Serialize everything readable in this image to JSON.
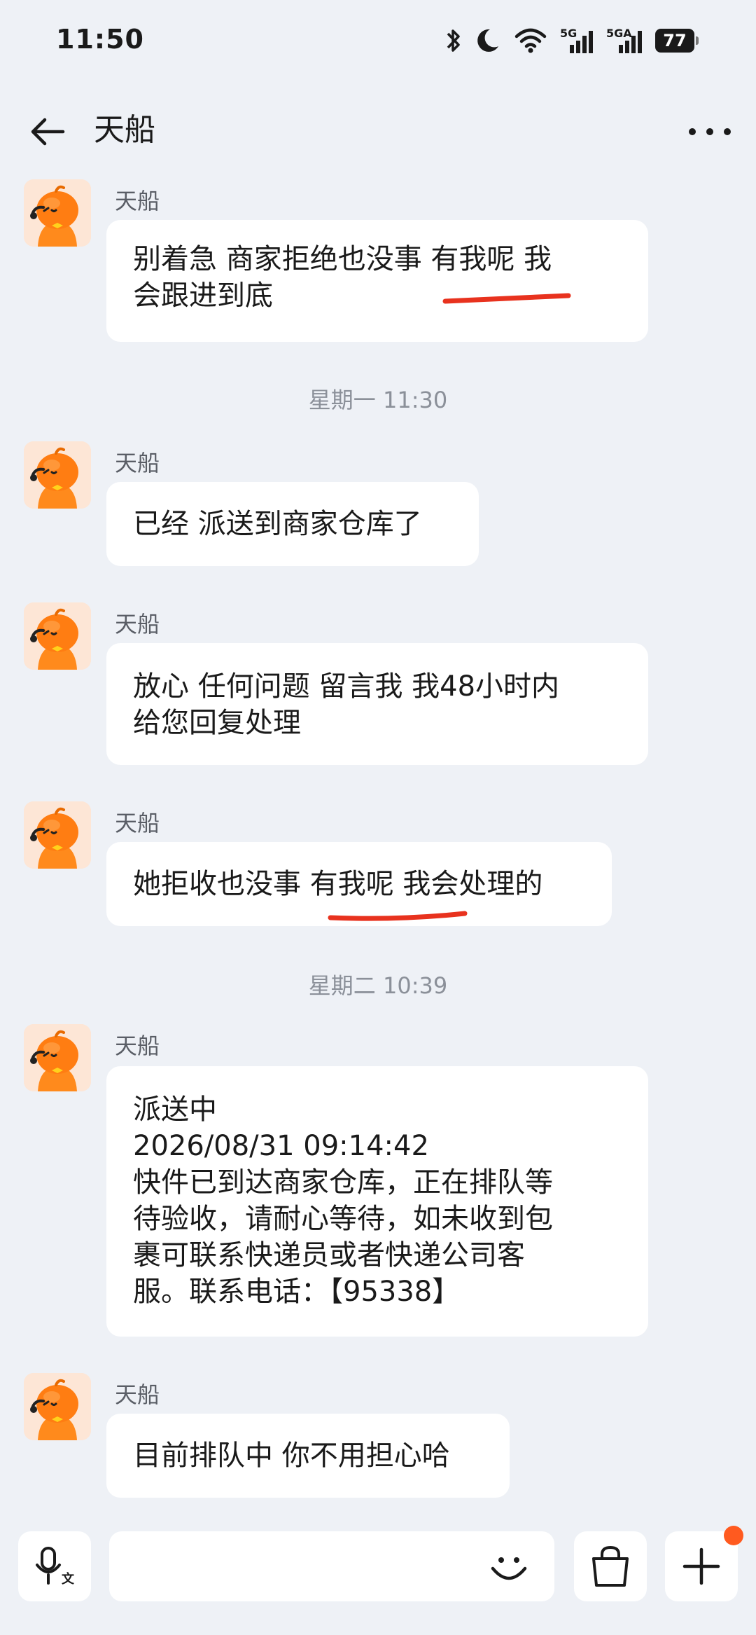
{
  "status_bar": {
    "time": "11:50",
    "signal1_label": "5G",
    "signal2_label": "5GA",
    "battery": "77",
    "icons": [
      "bluetooth-icon",
      "moon-icon",
      "wifi-icon",
      "signal-5g-icon",
      "signal-5ga-icon",
      "battery-icon"
    ]
  },
  "header": {
    "title": "天船",
    "back_icon": "arrow-left-icon",
    "more_icon": "more-horizontal-icon"
  },
  "messages": [
    {
      "sender": "天船",
      "text": "别着急 商家拒绝也没事 有我呢 我\n会跟进到底"
    },
    {
      "timestamp": "星期一 11:30"
    },
    {
      "sender": "天船",
      "text": "已经 派送到商家仓库了"
    },
    {
      "sender": "天船",
      "text": "放心 任何问题 留言我 我48小时内\n给您回复处理"
    },
    {
      "sender": "天船",
      "text": "她拒收也没事 有我呢 我会处理的"
    },
    {
      "timestamp": "星期二 10:39"
    },
    {
      "sender": "天船",
      "text": "派送中\n2026/08/31 09:14:42\n快件已到达商家仓库，正在排队等\n待验收，请耐心等待，如未收到包\n裹可联系快递员或者快递公司客\n服。联系电话：【95338】"
    },
    {
      "sender": "天船",
      "text": "目前排队中 你不用担心哈"
    }
  ],
  "annotation_color": "#e8321e",
  "input_bar": {
    "voice_icon": "microphone-translate-icon",
    "emoji_icon": "smiley-icon",
    "shop_icon": "shopping-bag-icon",
    "add_icon": "plus-icon",
    "notification_color": "#ff5a1f"
  }
}
